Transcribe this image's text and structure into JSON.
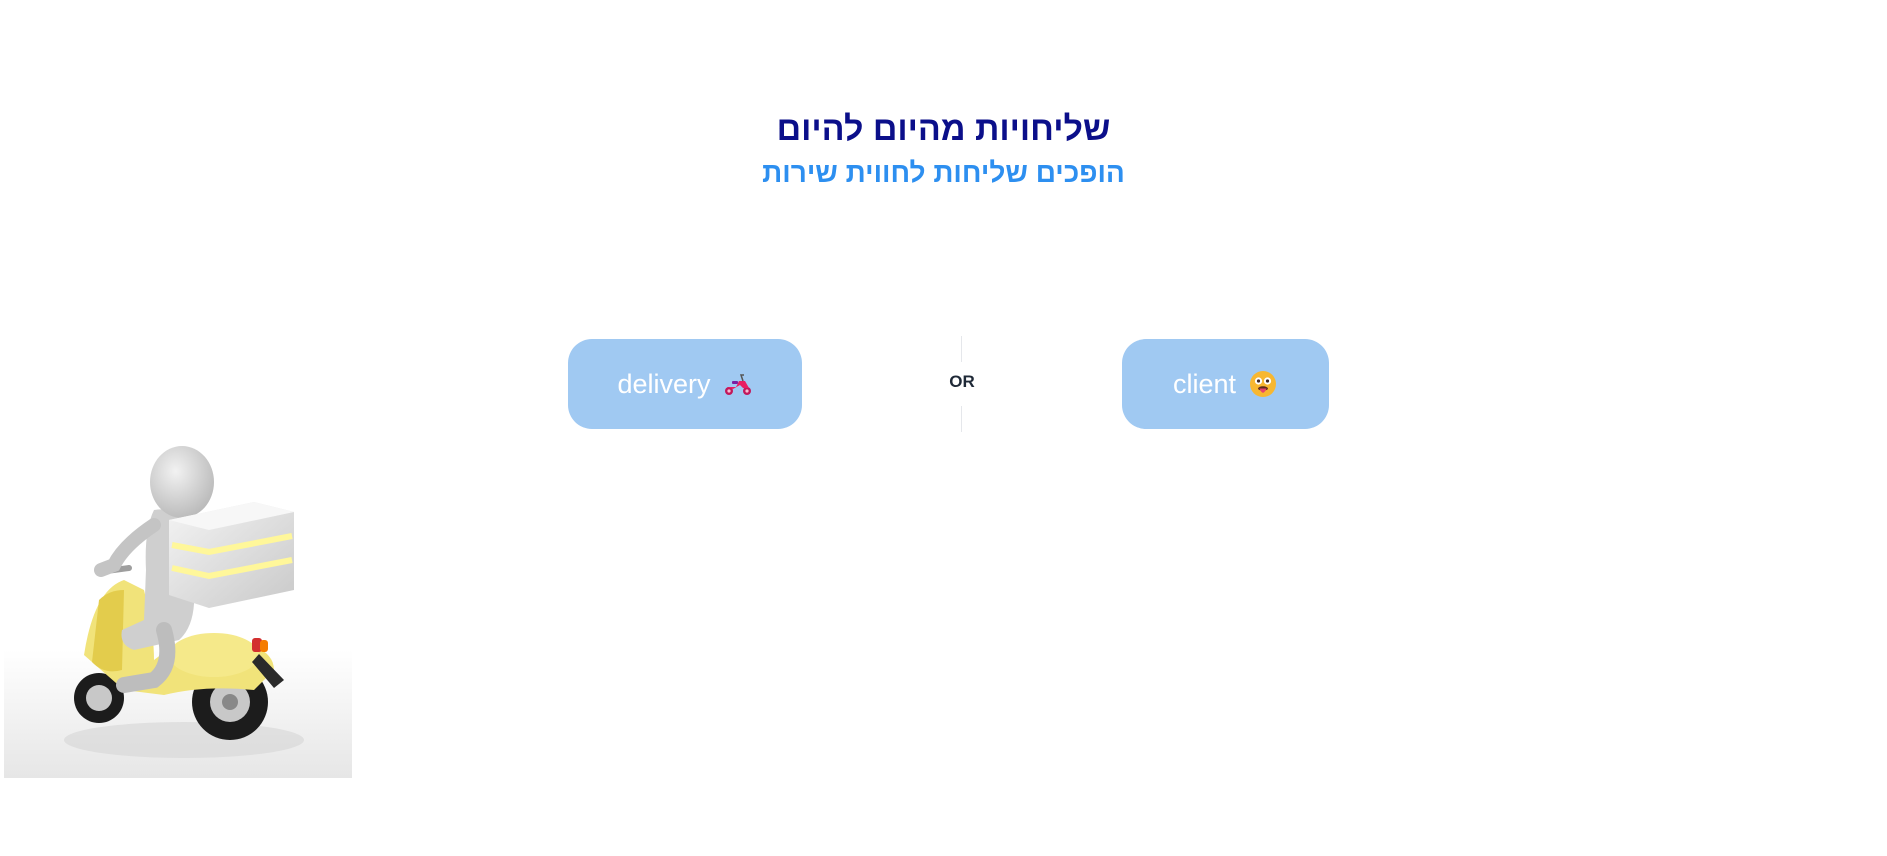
{
  "header": {
    "title": "שליחויות מהיום להיום",
    "subtitle": "הופכים שליחות לחווית שירות"
  },
  "actions": {
    "delivery_label": "delivery",
    "delivery_icon": "scooter-icon",
    "or_label": "OR",
    "client_label": "client",
    "client_icon": "tongue-face-emoji-icon"
  },
  "illustration": {
    "name": "delivery-person-on-scooter-illustration"
  },
  "colors": {
    "title": "#0b0f8a",
    "subtitle": "#2d8ff0",
    "button_bg": "#a0c9f2",
    "button_text": "#ffffff"
  }
}
